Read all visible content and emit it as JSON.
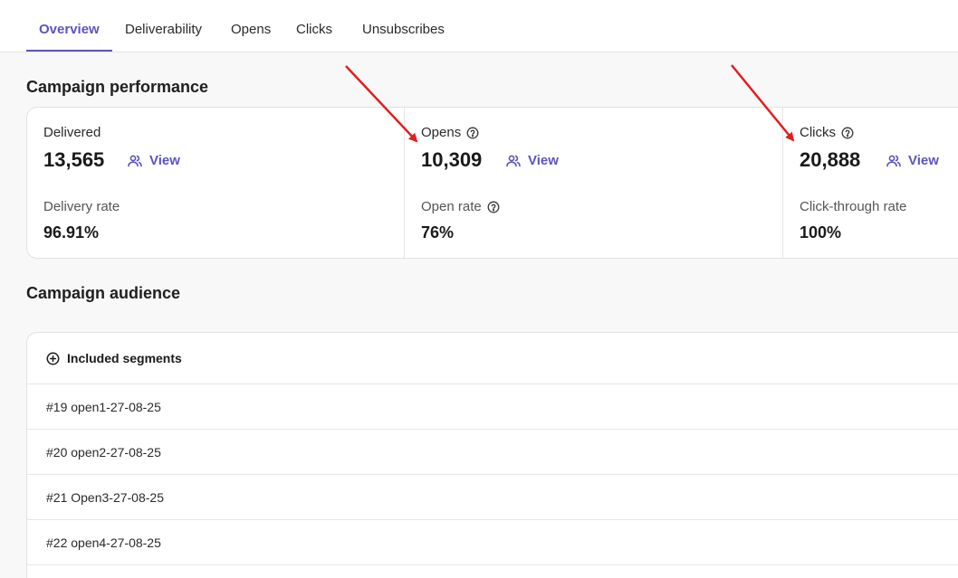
{
  "tabs": [
    {
      "label": "Overview",
      "active": true
    },
    {
      "label": "Deliverability"
    },
    {
      "label": "Opens"
    },
    {
      "label": "Clicks"
    },
    {
      "label": "Unsubscribes"
    }
  ],
  "performance": {
    "title": "Campaign performance",
    "metrics": [
      {
        "label": "Delivered",
        "value": "13,565",
        "view": "View",
        "rate_label": "Delivery rate",
        "rate_value": "96.91%"
      },
      {
        "label": "Opens",
        "value": "10,309",
        "view": "View",
        "rate_label": "Open rate",
        "rate_value": "76%"
      },
      {
        "label": "Clicks",
        "value": "20,888",
        "view": "View",
        "rate_label": "Click-through rate",
        "rate_value": "100%"
      }
    ]
  },
  "audience": {
    "title": "Campaign audience",
    "header": "Included segments",
    "segments": [
      "#19 open1-27-08-25",
      "#20 open2-27-08-25",
      "#21 Open3-27-08-25",
      "#22 open4-27-08-25"
    ]
  },
  "colors": {
    "accent": "#5b54c0",
    "annotation_arrow": "#e01f1f",
    "background": "#f8f8f8"
  }
}
